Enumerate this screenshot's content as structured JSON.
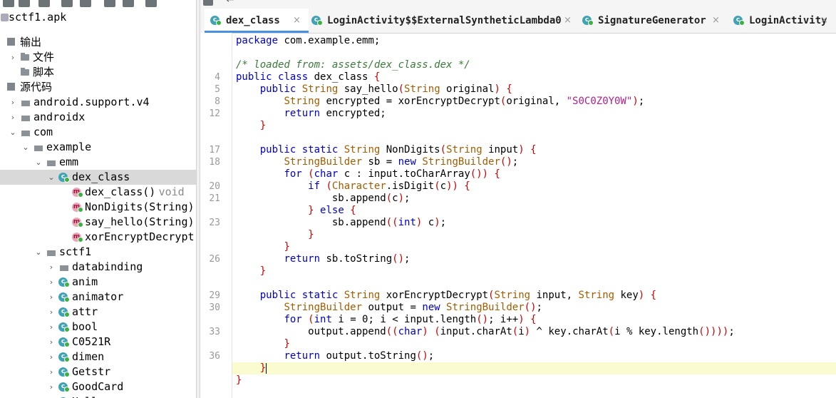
{
  "tree": {
    "root": "sctf1.apk",
    "items": [
      {
        "label": "输出",
        "icon": "output-icon"
      },
      {
        "label": "文件",
        "icon": "folder-icon"
      },
      {
        "label": "脚本",
        "icon": "folder-icon"
      },
      {
        "label": "源代码",
        "icon": "source-icon"
      },
      {
        "label": "android.support.v4",
        "icon": "package-icon"
      },
      {
        "label": "androidx",
        "icon": "package-icon"
      },
      {
        "label": "com",
        "icon": "package-icon"
      },
      {
        "label": "example",
        "icon": "package-icon"
      },
      {
        "label": "emm",
        "icon": "package-icon"
      },
      {
        "label": "dex_class",
        "icon": "class-icon"
      },
      {
        "label": "dex_class()",
        "type": "void",
        "icon": "method-icon"
      },
      {
        "label": "NonDigits(String)",
        "icon": "method-icon"
      },
      {
        "label": "say_hello(String)",
        "icon": "method-icon"
      },
      {
        "label": "xorEncryptDecrypt",
        "icon": "method-icon"
      },
      {
        "label": "sctf1",
        "icon": "package-icon"
      },
      {
        "label": "databinding",
        "icon": "package-icon"
      },
      {
        "label": "anim",
        "icon": "class-icon"
      },
      {
        "label": "animator",
        "icon": "class-icon"
      },
      {
        "label": "attr",
        "icon": "class-icon"
      },
      {
        "label": "bool",
        "icon": "class-icon"
      },
      {
        "label": "C0521R",
        "icon": "class-icon"
      },
      {
        "label": "dimen",
        "icon": "class-icon"
      },
      {
        "label": "Getstr",
        "icon": "class-icon"
      },
      {
        "label": "GoodCard",
        "icon": "class-icon"
      },
      {
        "label": "Hello",
        "icon": "class-icon"
      }
    ]
  },
  "tabs": [
    {
      "label": "dex_class",
      "active": true
    },
    {
      "label": "LoginActivity$$ExternalSyntheticLambda0",
      "active": false
    },
    {
      "label": "SignatureGenerator",
      "active": false
    },
    {
      "label": "LoginActivity",
      "active": false
    }
  ],
  "code": {
    "lines": [
      {
        "n": "",
        "text": "package com.example.emm;"
      },
      {
        "n": "",
        "text": ""
      },
      {
        "n": "",
        "text": "/* loaded from: assets/dex_class.dex */"
      },
      {
        "n": "4",
        "text": "public class dex_class {"
      },
      {
        "n": "5",
        "text": "    public String say_hello(String original) {"
      },
      {
        "n": "8",
        "text": "        String encrypted = xorEncryptDecrypt(original, \"S0C0Z0Y0W\");"
      },
      {
        "n": "12",
        "text": "        return encrypted;"
      },
      {
        "n": "",
        "text": "    }"
      },
      {
        "n": "",
        "text": ""
      },
      {
        "n": "17",
        "text": "    public static String NonDigits(String input) {"
      },
      {
        "n": "18",
        "text": "        StringBuilder sb = new StringBuilder();"
      },
      {
        "n": "",
        "text": "        for (char c : input.toCharArray()) {"
      },
      {
        "n": "20",
        "text": "            if (Character.isDigit(c)) {"
      },
      {
        "n": "21",
        "text": "                sb.append(c);"
      },
      {
        "n": "",
        "text": "            } else {"
      },
      {
        "n": "23",
        "text": "                sb.append((int) c);"
      },
      {
        "n": "",
        "text": "            }"
      },
      {
        "n": "",
        "text": "        }"
      },
      {
        "n": "26",
        "text": "        return sb.toString();"
      },
      {
        "n": "",
        "text": "    }"
      },
      {
        "n": "",
        "text": ""
      },
      {
        "n": "29",
        "text": "    public static String xorEncryptDecrypt(String input, String key) {"
      },
      {
        "n": "30",
        "text": "        StringBuilder output = new StringBuilder();"
      },
      {
        "n": "",
        "text": "        for (int i = 0; i < input.length(); i++) {"
      },
      {
        "n": "33",
        "text": "            output.append((char) (input.charAt(i) ^ key.charAt(i % key.length())));"
      },
      {
        "n": "",
        "text": "        }"
      },
      {
        "n": "36",
        "text": "        return output.toString();"
      },
      {
        "n": "",
        "text": "    }"
      },
      {
        "n": "",
        "text": "}"
      }
    ]
  },
  "colors": {
    "accent": "#4a90e2",
    "keyword": "#0000cc",
    "type": "#a25c00",
    "string": "#b0208a",
    "comment": "#3a7a3a",
    "highlight": "#fafcd0"
  }
}
